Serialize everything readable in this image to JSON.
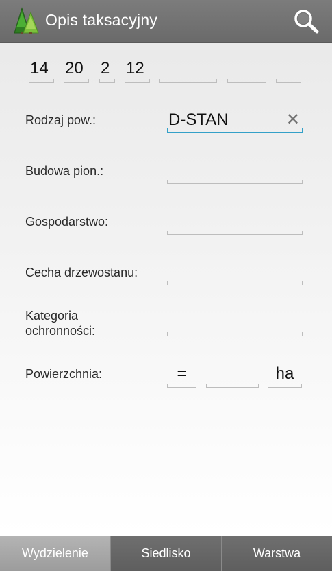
{
  "header": {
    "title": "Opis taksacyjny",
    "logo_icon": "forest-trees-icon",
    "search_icon": "search-icon"
  },
  "code_fields": [
    "14",
    "20",
    "2",
    "12",
    "",
    "",
    ""
  ],
  "form": {
    "rodzaj": {
      "label": "Rodzaj pow.:",
      "value": "D-STAN",
      "clear_icon": "close-icon"
    },
    "budowa": {
      "label": "Budowa pion.:",
      "value": ""
    },
    "gospodarstwo": {
      "label": "Gospodarstwo:",
      "value": ""
    },
    "cecha": {
      "label": "Cecha drzewostanu:",
      "value": ""
    },
    "kategoria": {
      "label_line1": "Kategoria",
      "label_line2": "ochronności:",
      "value": ""
    },
    "powierzchnia": {
      "label": "Powierzchnia:",
      "operator": "=",
      "value": "",
      "unit": "ha"
    }
  },
  "tabs": [
    {
      "label": "Wydzielenie",
      "active": true
    },
    {
      "label": "Siedlisko",
      "active": false
    },
    {
      "label": "Warstwa",
      "active": false
    }
  ],
  "colors": {
    "accent": "#33a0c8",
    "appbar": "#707070",
    "logo_green": "#3f9a2e"
  }
}
